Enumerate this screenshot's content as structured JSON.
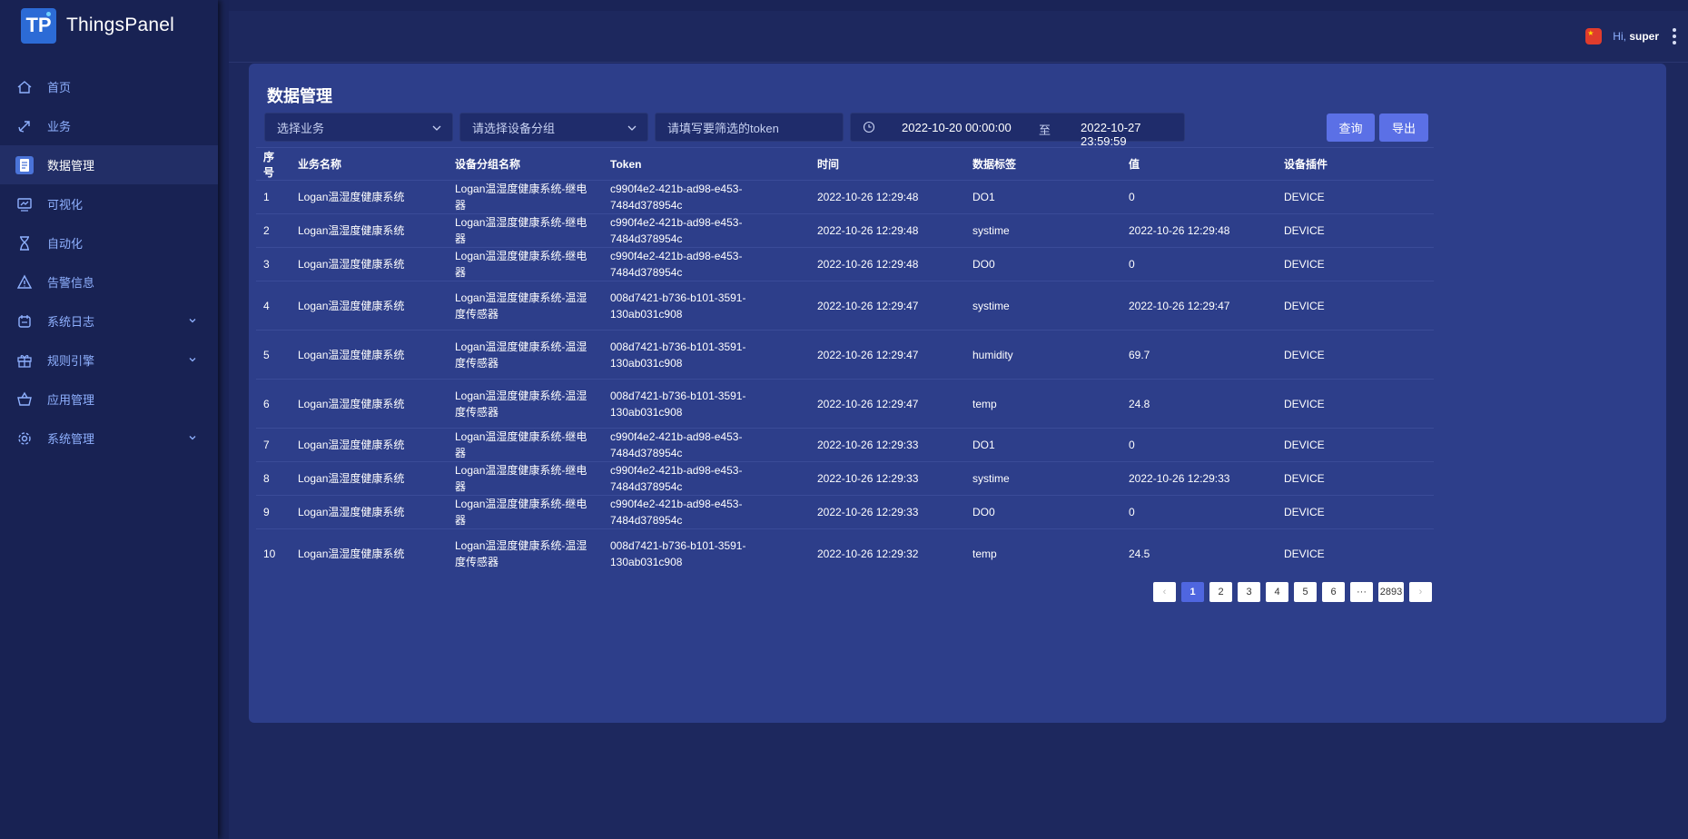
{
  "app": {
    "name": "ThingsPanel",
    "logo_text": "TP"
  },
  "sidebar": {
    "items": [
      {
        "label": "首页",
        "icon": "home-icon"
      },
      {
        "label": "业务",
        "icon": "rocket-icon"
      },
      {
        "label": "数据管理",
        "icon": "data-doc-icon",
        "active": true
      },
      {
        "label": "可视化",
        "icon": "monitor-icon"
      },
      {
        "label": "自动化",
        "icon": "hourglass-icon"
      },
      {
        "label": "告警信息",
        "icon": "warning-icon"
      },
      {
        "label": "系统日志",
        "icon": "log-icon",
        "expandable": true
      },
      {
        "label": "规则引擎",
        "icon": "gift-icon",
        "expandable": true
      },
      {
        "label": "应用管理",
        "icon": "basket-icon"
      },
      {
        "label": "系统管理",
        "icon": "gear-icon",
        "expandable": true
      }
    ]
  },
  "header": {
    "greeting": "Hi,",
    "username": "super",
    "flag_icon": "china-flag-icon"
  },
  "page": {
    "title": "数据管理",
    "filters": {
      "business_placeholder": "选择业务",
      "group_placeholder": "请选择设备分组",
      "token_placeholder": "请填写要筛选的token",
      "date_from": "2022-10-20 00:00:00",
      "date_sep": "至",
      "date_to": "2022-10-27 23:59:59"
    },
    "buttons": {
      "query": "查询",
      "export": "导出"
    }
  },
  "table": {
    "columns": [
      "序号",
      "业务名称",
      "设备分组名称",
      "Token",
      "时间",
      "数据标签",
      "值",
      "设备插件"
    ],
    "rows": [
      [
        "1",
        "Logan温湿度健康系统",
        "Logan温湿度健康系统-继电器",
        "c990f4e2-421b-ad98-e453-7484d378954c",
        "2022-10-26 12:29:48",
        "DO1",
        "0",
        "DEVICE"
      ],
      [
        "2",
        "Logan温湿度健康系统",
        "Logan温湿度健康系统-继电器",
        "c990f4e2-421b-ad98-e453-7484d378954c",
        "2022-10-26 12:29:48",
        "systime",
        "2022-10-26 12:29:48",
        "DEVICE"
      ],
      [
        "3",
        "Logan温湿度健康系统",
        "Logan温湿度健康系统-继电器",
        "c990f4e2-421b-ad98-e453-7484d378954c",
        "2022-10-26 12:29:48",
        "DO0",
        "0",
        "DEVICE"
      ],
      [
        "4",
        "Logan温湿度健康系统",
        "Logan温湿度健康系统-温湿度传感器",
        "008d7421-b736-b101-3591-130ab031c908",
        "2022-10-26 12:29:47",
        "systime",
        "2022-10-26 12:29:47",
        "DEVICE"
      ],
      [
        "5",
        "Logan温湿度健康系统",
        "Logan温湿度健康系统-温湿度传感器",
        "008d7421-b736-b101-3591-130ab031c908",
        "2022-10-26 12:29:47",
        "humidity",
        "69.7",
        "DEVICE"
      ],
      [
        "6",
        "Logan温湿度健康系统",
        "Logan温湿度健康系统-温湿度传感器",
        "008d7421-b736-b101-3591-130ab031c908",
        "2022-10-26 12:29:47",
        "temp",
        "24.8",
        "DEVICE"
      ],
      [
        "7",
        "Logan温湿度健康系统",
        "Logan温湿度健康系统-继电器",
        "c990f4e2-421b-ad98-e453-7484d378954c",
        "2022-10-26 12:29:33",
        "DO1",
        "0",
        "DEVICE"
      ],
      [
        "8",
        "Logan温湿度健康系统",
        "Logan温湿度健康系统-继电器",
        "c990f4e2-421b-ad98-e453-7484d378954c",
        "2022-10-26 12:29:33",
        "systime",
        "2022-10-26 12:29:33",
        "DEVICE"
      ],
      [
        "9",
        "Logan温湿度健康系统",
        "Logan温湿度健康系统-继电器",
        "c990f4e2-421b-ad98-e453-7484d378954c",
        "2022-10-26 12:29:33",
        "DO0",
        "0",
        "DEVICE"
      ],
      [
        "10",
        "Logan温湿度健康系统",
        "Logan温湿度健康系统-温湿度传感器",
        "008d7421-b736-b101-3591-130ab031c908",
        "2022-10-26 12:29:32",
        "temp",
        "24.5",
        "DEVICE"
      ]
    ]
  },
  "pagination": {
    "prev": "‹",
    "pages": [
      "1",
      "2",
      "3",
      "4",
      "5",
      "6"
    ],
    "current": "1",
    "ellipsis": "···",
    "last": "2893",
    "next": "›"
  },
  "colors": {
    "sidebar_bg": "#182253",
    "main_bg": "#1d285e",
    "card_bg": "#2d3e8a",
    "accent": "#5b70e6",
    "nav_text": "#8fb1ff"
  }
}
